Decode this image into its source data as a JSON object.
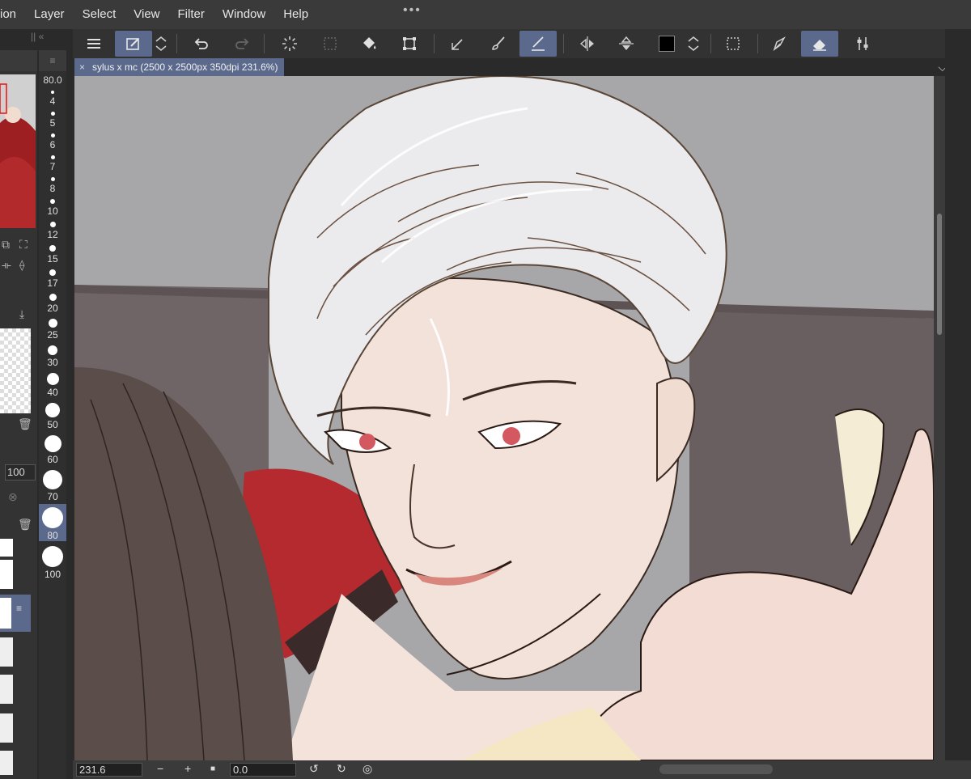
{
  "menu": {
    "items": [
      "ion",
      "Layer",
      "Select",
      "View",
      "Filter",
      "Window",
      "Help"
    ],
    "more": "•••"
  },
  "document": {
    "tab_title": "sylus x mc (2500 x 2500px 350dpi 231.6%)",
    "close_glyph": "×",
    "chevron_glyph": "⌵"
  },
  "brush_panel": {
    "current_size": "80.0",
    "sizes": [
      "4",
      "5",
      "6",
      "7",
      "8",
      "10",
      "12",
      "15",
      "17",
      "20",
      "25",
      "30",
      "40",
      "50",
      "60",
      "70",
      "80",
      "100"
    ],
    "selected": "80"
  },
  "layer_panel": {
    "opacity": "100"
  },
  "status": {
    "zoom": "231.6",
    "rotation": "0.0",
    "zoom_out": "−",
    "zoom_in": "+"
  },
  "icons": {
    "menu": "hamburger-icon",
    "subview": "subview-icon",
    "undo": "undo-icon",
    "redo": "redo-icon",
    "loading": "loading-spinner-icon",
    "deselect": "clear-selection-icon",
    "fill": "fill-bucket-icon",
    "transform": "transform-icon",
    "pen": "pen-icon",
    "brush": "brush-icon",
    "flip_h": "flip-horizontal-icon",
    "flip_v": "flip-vertical-icon",
    "color": "color-swatch-icon",
    "select_rect": "rect-select-icon",
    "eraser": "eraser-icon",
    "settings": "tool-settings-icon"
  },
  "colors": {
    "accent": "#5b6a8c",
    "current_color": "#000000"
  }
}
